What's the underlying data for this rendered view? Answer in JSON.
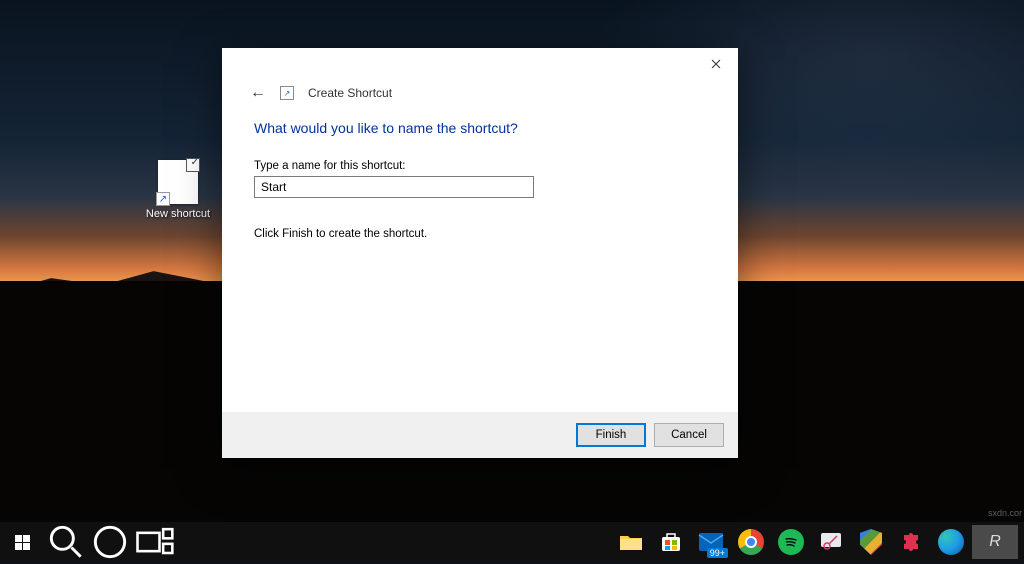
{
  "desktop_icon": {
    "label": "New shortcut"
  },
  "dialog": {
    "title": "Create Shortcut",
    "heading": "What would you like to name the shortcut?",
    "field_label": "Type a name for this shortcut:",
    "input_value": "Start",
    "helper": "Click Finish to create the shortcut.",
    "buttons": {
      "finish": "Finish",
      "cancel": "Cancel"
    }
  },
  "taskbar": {
    "mail_badge": "99+"
  }
}
